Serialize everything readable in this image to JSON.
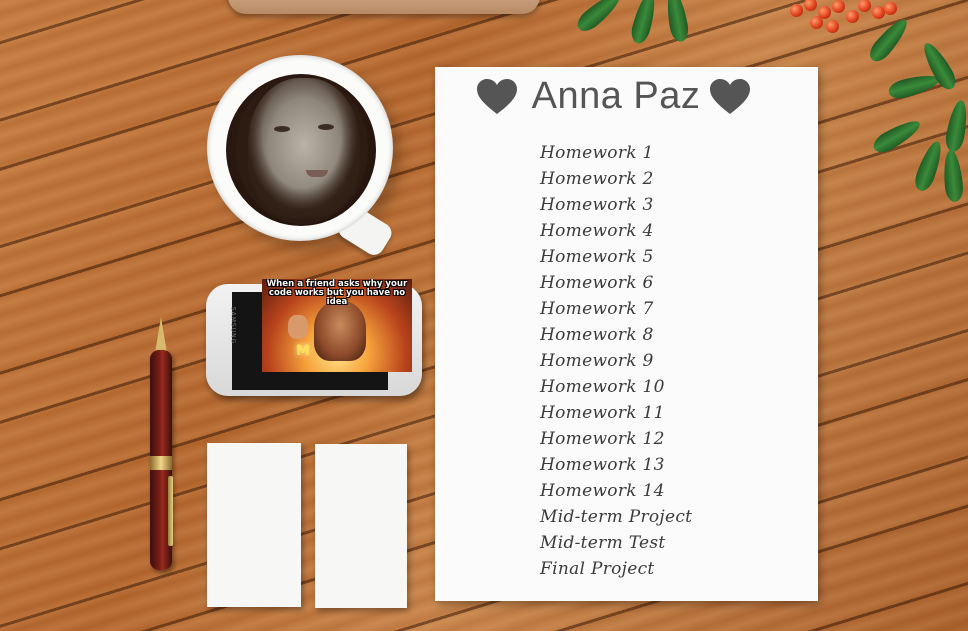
{
  "page": {
    "title": "Anna Paz"
  },
  "phone": {
    "brand": "SAMSUNG",
    "meme_caption": "When a friend asks why your code works but you have no idea",
    "meme_overlay": "M"
  },
  "assignments": [
    {
      "label": "Homework 1"
    },
    {
      "label": "Homework 2"
    },
    {
      "label": "Homework 3"
    },
    {
      "label": "Homework 4"
    },
    {
      "label": "Homework 5"
    },
    {
      "label": "Homework 6"
    },
    {
      "label": "Homework 7"
    },
    {
      "label": "Homework 8"
    },
    {
      "label": "Homework 9"
    },
    {
      "label": "Homework 10"
    },
    {
      "label": "Homework 11"
    },
    {
      "label": "Homework 12"
    },
    {
      "label": "Homework 13"
    },
    {
      "label": "Homework 14"
    },
    {
      "label": "Mid-term Project"
    },
    {
      "label": "Mid-term Test"
    },
    {
      "label": "Final Project"
    }
  ],
  "icons": {
    "heart": "heart-icon",
    "coffee_portrait": "coffee-cup-portrait",
    "phone": "smartphone"
  },
  "colors": {
    "heart": "#555555",
    "title": "#555555",
    "list_text": "#3b3b3b",
    "paper": "#fbfbfb"
  }
}
